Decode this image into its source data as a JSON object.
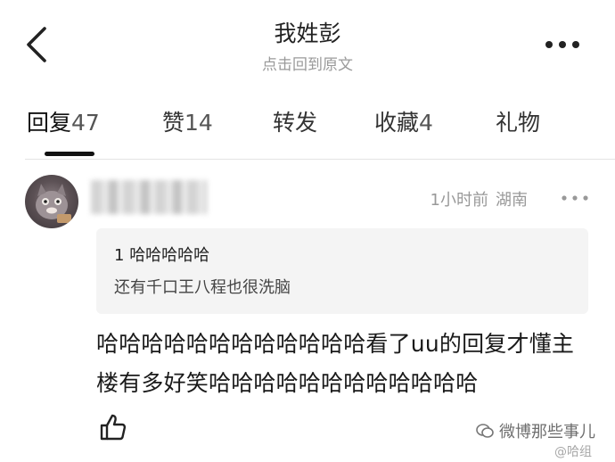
{
  "header": {
    "title": "我姓彭",
    "subtitle": "点击回到原文"
  },
  "tabs": [
    {
      "label": "回复",
      "count": "47"
    },
    {
      "label": "赞",
      "count": "14"
    },
    {
      "label": "转发",
      "count": ""
    },
    {
      "label": "收藏",
      "count": "4"
    },
    {
      "label": "礼物",
      "count": ""
    }
  ],
  "comment": {
    "time": "1小时前",
    "location": "湖南",
    "quote": {
      "count": "1",
      "title": "哈哈哈哈哈",
      "text": "还有千口王八程也很洗脑"
    },
    "text": "哈哈哈哈哈哈哈哈哈哈哈哈看了uu的回复才懂主楼有多好笑哈哈哈哈哈哈哈哈哈哈哈哈"
  },
  "watermark": {
    "line1": "微博那些事儿",
    "line2": "@哈组"
  }
}
